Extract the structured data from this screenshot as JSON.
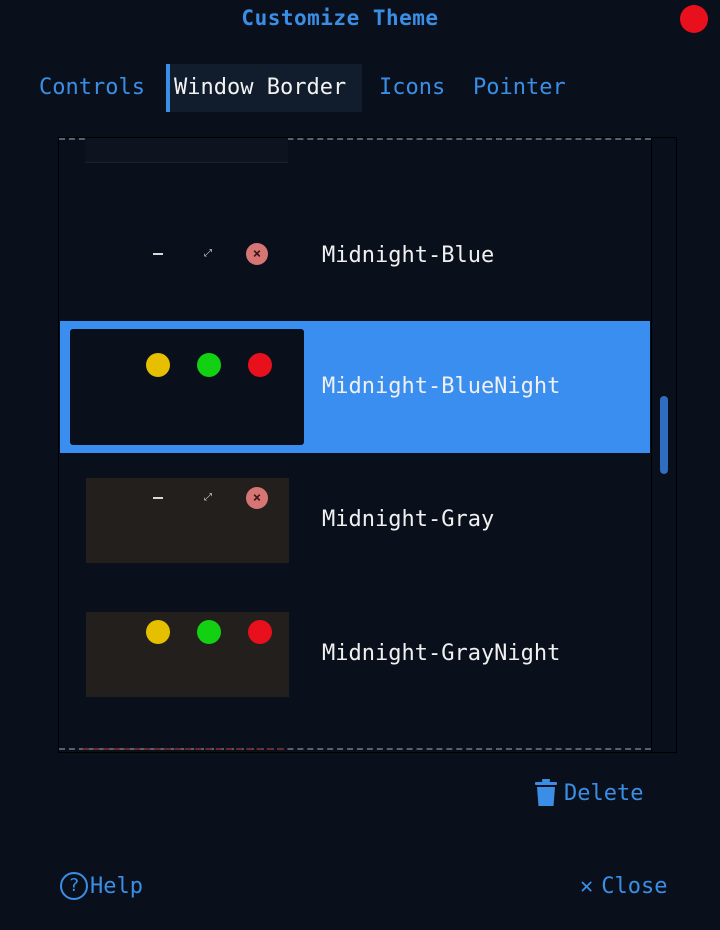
{
  "window": {
    "title": "Customize Theme"
  },
  "tabs": [
    {
      "label": "Controls"
    },
    {
      "label": "Window Border"
    },
    {
      "label": "Icons"
    },
    {
      "label": "Pointer"
    }
  ],
  "active_tab": "Window Border",
  "themes": [
    {
      "label": "Midnight-Blue",
      "buttons": "symbols"
    },
    {
      "label": "Midnight-BlueNight",
      "buttons": "dots",
      "selected": true
    },
    {
      "label": "Midnight-Gray",
      "buttons": "symbols"
    },
    {
      "label": "Midnight-GrayNight",
      "buttons": "dots"
    }
  ],
  "actions": {
    "delete_label": "Delete",
    "help_label": "Help",
    "help_glyph": "?",
    "close_label": "Close",
    "close_glyph": "✕"
  },
  "colors": {
    "accent": "#3a8ee6",
    "selection": "#3a8ef0",
    "background": "#0a101b",
    "dot_yellow": "#e6c000",
    "dot_green": "#12d012",
    "dot_red": "#e8101c"
  },
  "icons": {
    "window_close": "close-dot-icon",
    "delete": "trash-icon",
    "help": "question-circle-icon",
    "close": "x-icon"
  }
}
